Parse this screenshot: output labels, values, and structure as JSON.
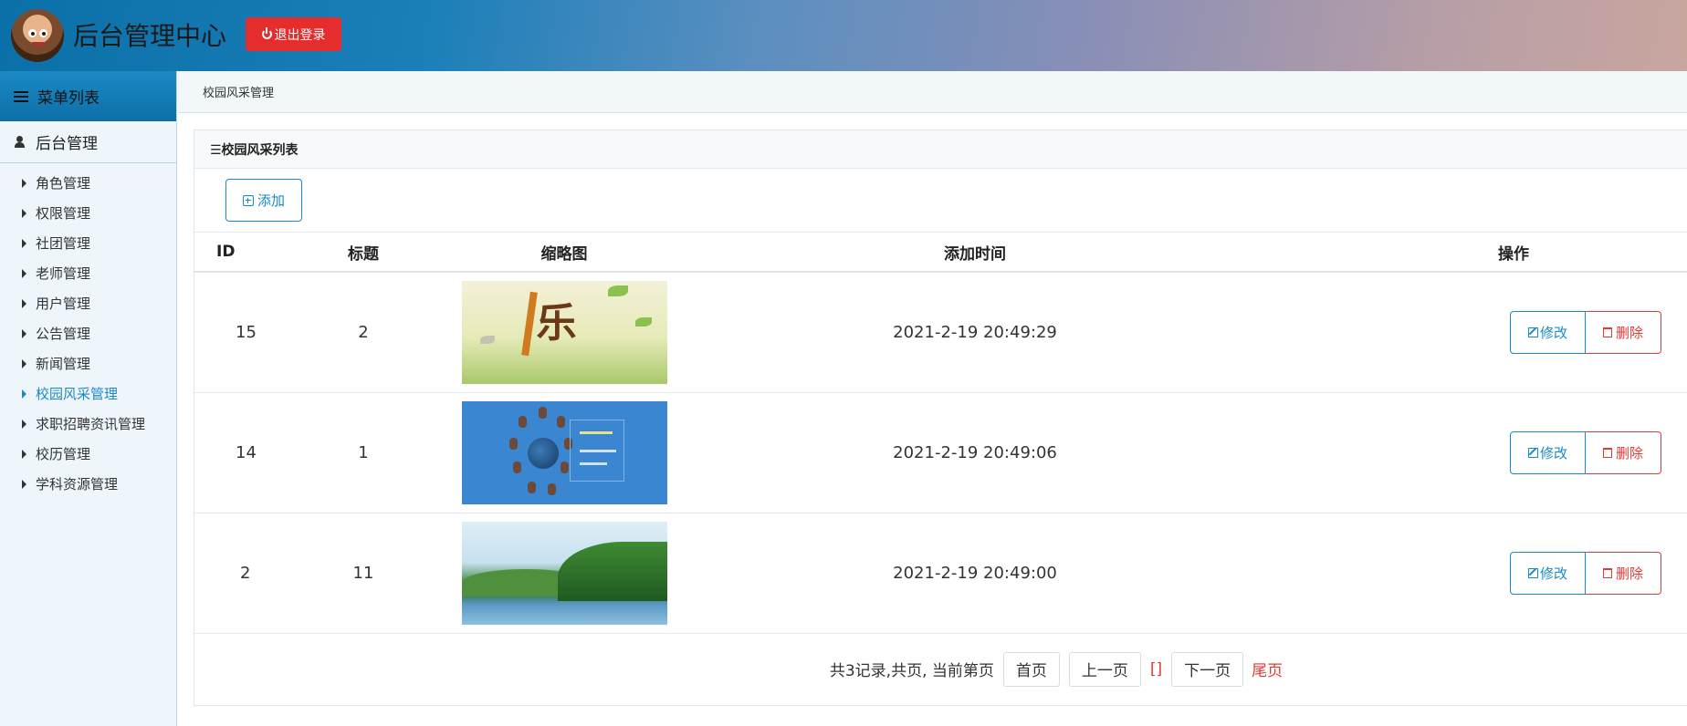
{
  "header": {
    "title": "后台管理中心",
    "logout_label": "退出登录"
  },
  "sidebar": {
    "menu_title": "菜单列表",
    "group_title": "后台管理",
    "items": [
      {
        "label": "角色管理",
        "active": false
      },
      {
        "label": "权限管理",
        "active": false
      },
      {
        "label": "社团管理",
        "active": false
      },
      {
        "label": "老师管理",
        "active": false
      },
      {
        "label": "用户管理",
        "active": false
      },
      {
        "label": "公告管理",
        "active": false
      },
      {
        "label": "新闻管理",
        "active": false
      },
      {
        "label": "校园风采管理",
        "active": true
      },
      {
        "label": "求职招聘资讯管理",
        "active": false
      },
      {
        "label": "校历管理",
        "active": false
      },
      {
        "label": "学科资源管理",
        "active": false
      }
    ]
  },
  "breadcrumb": "校园风采管理",
  "panel": {
    "title": "☰校园风采列表",
    "add_label": "添加"
  },
  "table": {
    "headers": [
      "ID",
      "标题",
      "缩略图",
      "添加时间",
      "操作"
    ],
    "rows": [
      {
        "id": "15",
        "title": "2",
        "time": "2021-2-19 20:49:29"
      },
      {
        "id": "14",
        "title": "1",
        "time": "2021-2-19 20:49:06"
      },
      {
        "id": "2",
        "title": "11",
        "time": "2021-2-19 20:49:00"
      }
    ],
    "edit_label": "修改",
    "delete_label": "删除"
  },
  "pagination": {
    "summary": "共3记录,共页, 当前第页",
    "first": "首页",
    "prev": "上一页",
    "current": "[]",
    "next": "下一页",
    "last": "尾页"
  },
  "colors": {
    "accent": "#1a8ac6",
    "danger": "#e53935"
  }
}
